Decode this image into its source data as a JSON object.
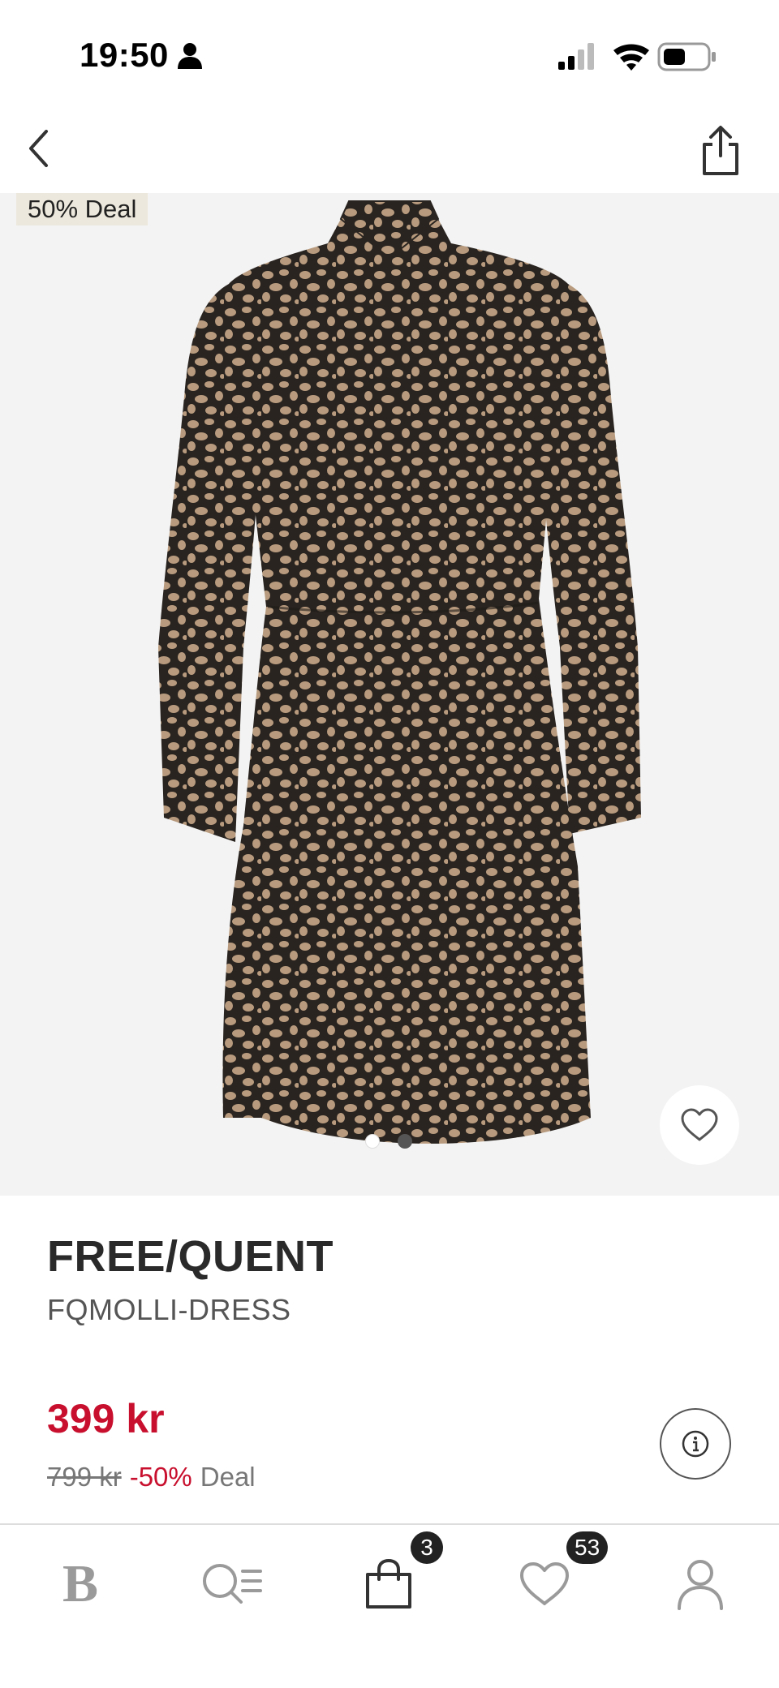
{
  "status_bar": {
    "time": "19:50",
    "person_icon": "person-icon",
    "signal_icon": "cellular-signal-icon",
    "wifi_icon": "wifi-icon",
    "battery_icon": "battery-icon"
  },
  "nav": {
    "back_icon": "chevron-left-icon",
    "share_icon": "share-icon"
  },
  "product_image": {
    "deal_badge": "50% Deal",
    "carousel_page": 1,
    "carousel_total": 2,
    "favorite_icon": "heart-outline-icon"
  },
  "product": {
    "brand": "FREE/QUENT",
    "name": "FQMOLLI-DRESS",
    "price": "399 kr",
    "old_price": "799 kr",
    "discount": "-50%",
    "deal_label": "Deal",
    "info_icon": "info-icon"
  },
  "tab_bar": {
    "logo": "B",
    "search_icon": "search-list-icon",
    "bag_icon": "shopping-bag-icon",
    "bag_count": "3",
    "favorites_icon": "heart-outline-icon",
    "favorites_count": "53",
    "profile_icon": "profile-icon"
  },
  "colors": {
    "accent_red": "#c8102e",
    "deal_badge_bg": "#ede8dd",
    "image_bg": "#f3f3f3"
  }
}
